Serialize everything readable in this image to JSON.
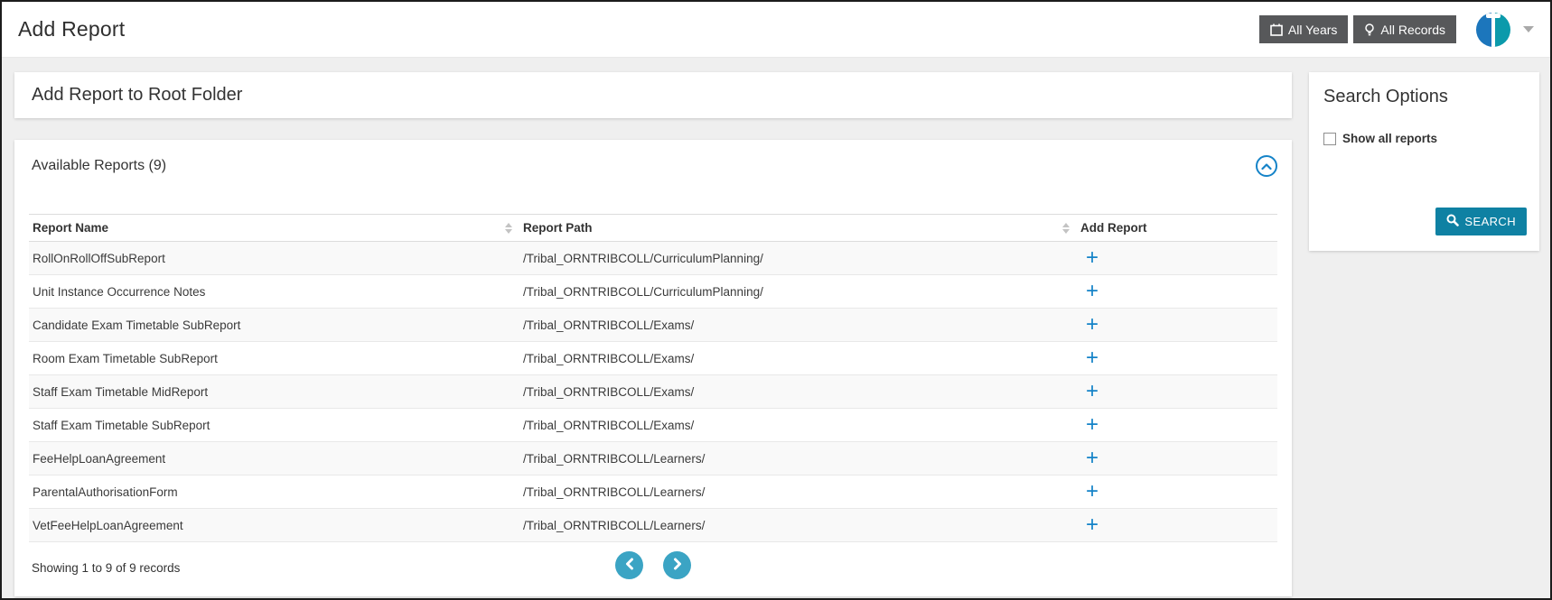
{
  "page": {
    "title": "Add Report"
  },
  "header": {
    "all_years": {
      "label": "All Years",
      "icon": "calendar-icon"
    },
    "all_records": {
      "label": "All Records",
      "icon": "lightbulb-icon"
    },
    "avatar": {
      "left_color": "#1c76bc",
      "right_color": "#0b9aab"
    }
  },
  "main": {
    "panel_title": "Add Report to Root Folder",
    "section_title": "Available Reports (9)",
    "table": {
      "columns": [
        "Report Name",
        "Report Path",
        "Add Report"
      ],
      "add_icon": "+",
      "rows": [
        {
          "name": "RollOnRollOffSubReport",
          "path": "/Tribal_ORNTRIBCOLL/CurriculumPlanning/"
        },
        {
          "name": "Unit Instance Occurrence Notes",
          "path": "/Tribal_ORNTRIBCOLL/CurriculumPlanning/"
        },
        {
          "name": "Candidate Exam Timetable SubReport",
          "path": "/Tribal_ORNTRIBCOLL/Exams/"
        },
        {
          "name": "Room Exam Timetable SubReport",
          "path": "/Tribal_ORNTRIBCOLL/Exams/"
        },
        {
          "name": "Staff Exam Timetable MidReport",
          "path": "/Tribal_ORNTRIBCOLL/Exams/"
        },
        {
          "name": "Staff Exam Timetable SubReport",
          "path": "/Tribal_ORNTRIBCOLL/Exams/"
        },
        {
          "name": "FeeHelpLoanAgreement",
          "path": "/Tribal_ORNTRIBCOLL/Learners/"
        },
        {
          "name": "ParentalAuthorisationForm",
          "path": "/Tribal_ORNTRIBCOLL/Learners/"
        },
        {
          "name": "VetFeeHelpLoanAgreement",
          "path": "/Tribal_ORNTRIBCOLL/Learners/"
        }
      ]
    },
    "footer": {
      "summary": "Showing 1 to 9 of 9 records"
    }
  },
  "sidebar": {
    "title": "Search Options",
    "checkbox_label": "Show all reports",
    "checkbox_checked": false,
    "search_button": "SEARCH"
  },
  "colors": {
    "accent_blue": "#1583c8",
    "pager_teal": "#3ba4c4",
    "search_button": "#0f81a3",
    "dark_button": "#57585a",
    "page_background": "#efefef",
    "row_stripe": "#f9f9f9"
  }
}
